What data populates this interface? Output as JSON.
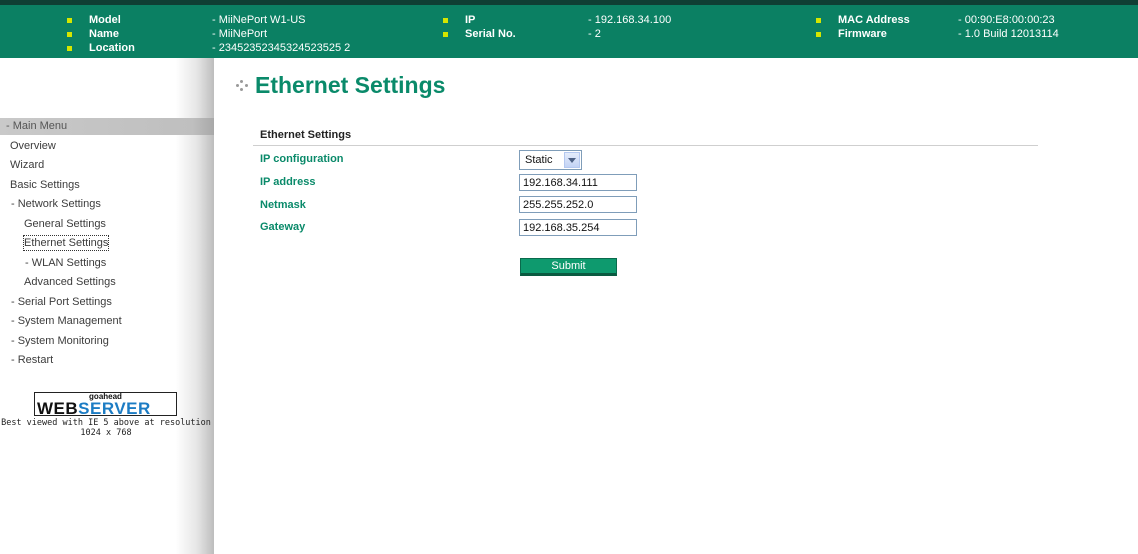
{
  "header": {
    "rows": [
      [
        {
          "label": "Model",
          "value": "- MiiNePort W1-US"
        },
        {
          "label": "IP",
          "value": "- 192.168.34.100"
        },
        {
          "label": "MAC Address",
          "value": "- 00:90:E8:00:00:23"
        }
      ],
      [
        {
          "label": "Name",
          "value": "- MiiNePort"
        },
        {
          "label": "Serial No.",
          "value": "- 2"
        },
        {
          "label": "Firmware",
          "value": "- 1.0 Build 12013114"
        }
      ],
      [
        {
          "label": "Location",
          "value": "- 23452352345324523525 2"
        }
      ]
    ],
    "colors": {
      "bar": "#0b8063",
      "bullet": "#d5e600"
    }
  },
  "sidebar": {
    "menu_title": "- Main Menu",
    "items": [
      {
        "label": "Overview"
      },
      {
        "label": "Wizard"
      },
      {
        "label": "Basic Settings"
      },
      {
        "label": "- Network Settings"
      },
      {
        "label": "General Settings"
      },
      {
        "label": "Ethernet Settings",
        "selected": true
      },
      {
        "label": "- WLAN Settings"
      },
      {
        "label": "Advanced Settings"
      },
      {
        "label": "- Serial Port Settings"
      },
      {
        "label": "- System Management"
      },
      {
        "label": "- System Monitoring"
      },
      {
        "label": "- Restart"
      }
    ],
    "logo": {
      "top_text": "goahead",
      "web": "WEB",
      "server": "SERVER"
    },
    "best_viewed": "Best viewed with IE 5 above at resolution 1024 x 768"
  },
  "main": {
    "page_title": "Ethernet Settings",
    "section_title": "Ethernet Settings",
    "fields": {
      "ip_config": {
        "label": "IP configuration",
        "value": "Static"
      },
      "ip_address": {
        "label": "IP address",
        "value": "192.168.34.111"
      },
      "netmask": {
        "label": "Netmask",
        "value": "255.255.252.0"
      },
      "gateway": {
        "label": "Gateway",
        "value": "192.168.35.254"
      }
    },
    "submit_label": "Submit",
    "accent": "#0a8a6a"
  }
}
